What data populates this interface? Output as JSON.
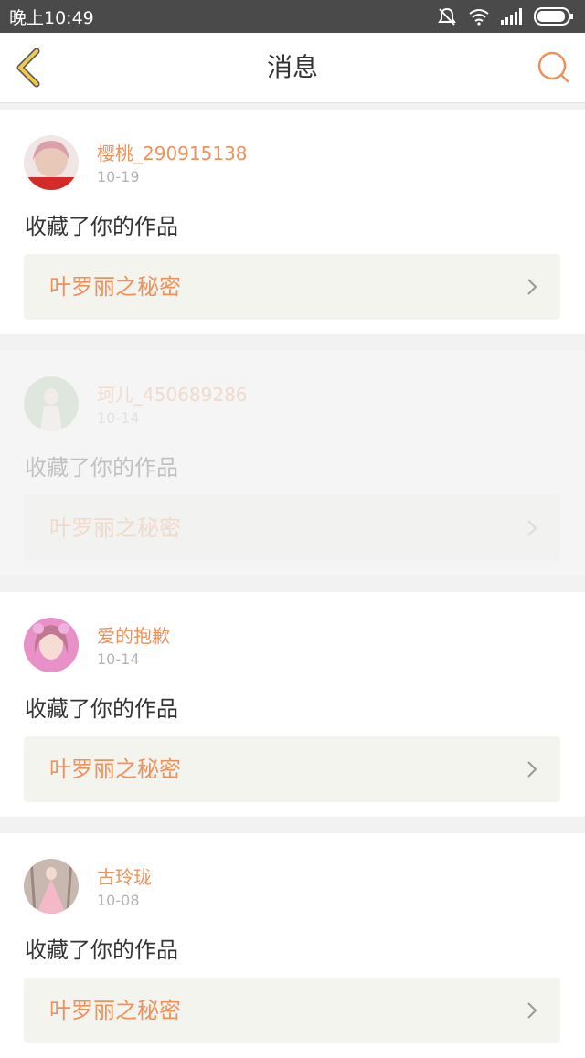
{
  "status_bar": {
    "time": "晚上10:49",
    "icons": [
      "mute-icon",
      "wifi-icon",
      "signal-icon",
      "battery-icon"
    ]
  },
  "nav": {
    "title": "消息",
    "back_icon": "chevron-left-icon",
    "search_icon": "search-icon"
  },
  "colors": {
    "accent": "#f0915a",
    "back_icon": "#f2c94c",
    "status_bar_bg": "#4a4a4a",
    "work_link_bg": "#f4f4ef"
  },
  "messages": [
    {
      "user": "樱桃_290915138",
      "date": "10-19",
      "action": "收藏了你的作品",
      "work": "叶罗丽之秘密",
      "faded": false
    },
    {
      "user": "珂儿_450689286",
      "date": "10-14",
      "action": "收藏了你的作品",
      "work": "叶罗丽之秘密",
      "faded": true
    },
    {
      "user": "爱的抱歉",
      "date": "10-14",
      "action": "收藏了你的作品",
      "work": "叶罗丽之秘密",
      "faded": false
    },
    {
      "user": "古玲珑",
      "date": "10-08",
      "action": "收藏了你的作品",
      "work": "叶罗丽之秘密",
      "faded": false
    }
  ]
}
